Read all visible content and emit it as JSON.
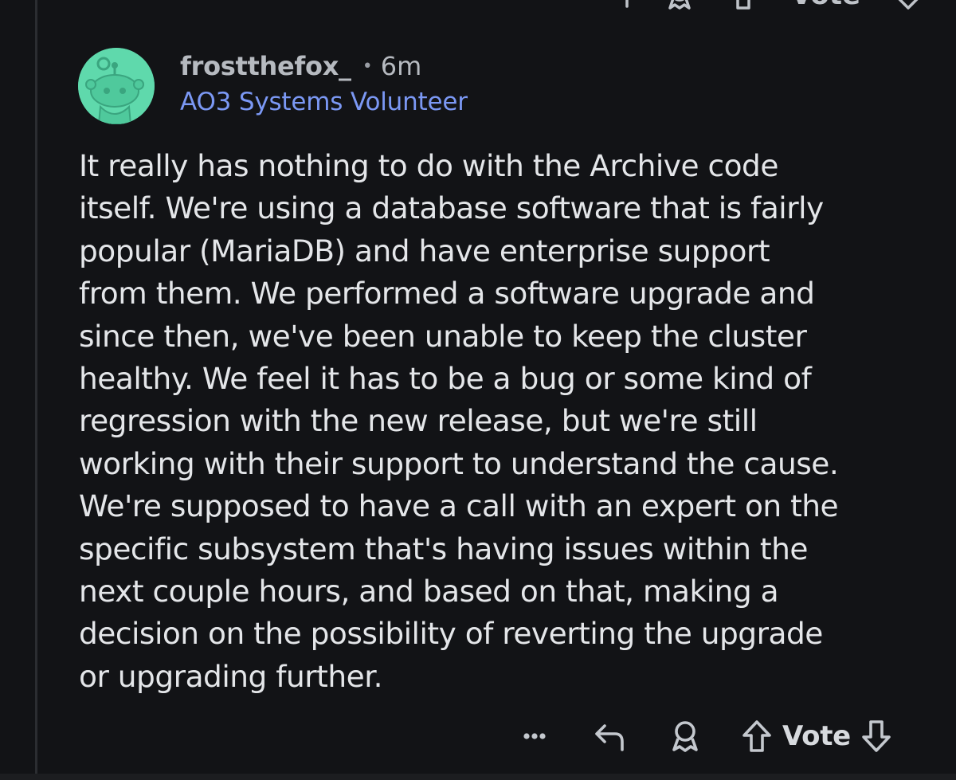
{
  "comment": {
    "author": "frostthefox_",
    "separator": "•",
    "time": "6m",
    "flair": "AO3 Systems Volunteer",
    "body": "It really has nothing to do with the Archive code\nitself. We're using a database software that is fairly\npopular (MariaDB) and have enterprise support\nfrom them. We performed a software upgrade and\nsince then, we've been unable to keep the cluster\nhealthy. We feel it has to be a bug or some kind of\nregression with the new release, but we're still\nworking with their support to understand the cause.\nWe're supposed to have a call with an expert on the\nspecific subsystem that's having issues within the\nnext couple hours, and based on that, making a\ndecision on the possibility of reverting the upgrade\nor upgrading further."
  },
  "actions": {
    "more_icon": "more-dots-icon",
    "reply_icon": "reply-arrow-icon",
    "award_icon": "award-icon",
    "upvote_icon": "upvote-arrow-icon",
    "vote_label": "Vote",
    "downvote_icon": "downvote-arrow-icon"
  },
  "top_actions": {
    "vote_label": "Vote"
  },
  "colors": {
    "background": "#121316",
    "body_text": "#e4e6e9",
    "flair": "#7b98f4",
    "avatar": "#5fd9ac",
    "meta_text": "#b6bac0"
  }
}
